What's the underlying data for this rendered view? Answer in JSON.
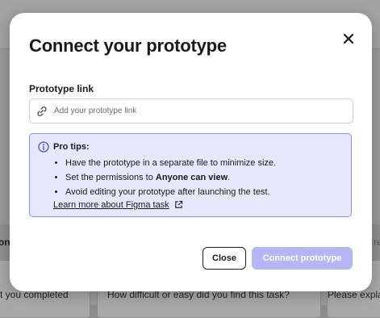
{
  "background": {
    "left_bold_fragment": "on",
    "right_text_fragment": "re",
    "card_left_text": "t you completed",
    "card_mid_text": "How difficult or easy did you find this task?",
    "card_right_text": "Please expla"
  },
  "modal": {
    "title": "Connect your prototype",
    "close_icon": "close-icon"
  },
  "prototype_link": {
    "label": "Prototype link",
    "placeholder": "Add your prototype link",
    "value": "",
    "icon": "link-icon"
  },
  "pro_tips": {
    "title": "Pro tips:",
    "icon": "info-icon",
    "items": [
      {
        "text": "Have the prototype in a separate file to minimize size."
      },
      {
        "prefix": "Set the permissions to ",
        "bold": "Anyone can view",
        "suffix": "."
      },
      {
        "text": "Avoid editing your prototype after launching the test."
      }
    ],
    "link_text": "Learn more about Figma task",
    "link_icon": "external-link-icon"
  },
  "buttons": {
    "close_label": "Close",
    "connect_label": "Connect prototype"
  },
  "colors": {
    "accent_disabled": "#b4b6f5",
    "tips_background": "#e7e8ff",
    "tips_border": "#8d93ea",
    "info_icon": "#4b52d6"
  }
}
